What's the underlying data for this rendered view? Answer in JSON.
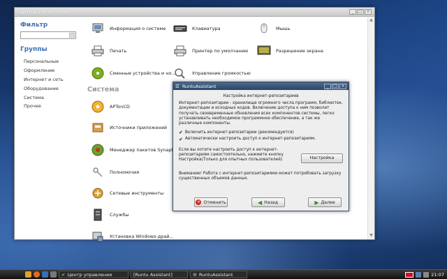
{
  "main_window": {
    "title": "Центр управления",
    "sidebar": {
      "filter_label": "Фильтр",
      "filter_value": "",
      "groups_label": "Группы",
      "groups": [
        "Персональные",
        "Оформление",
        "Интернет и сеть",
        "Оборудование",
        "Система",
        "Прочее"
      ]
    },
    "hardware_items": [
      {
        "label": "Информация о системе",
        "icon": "computer-icon"
      },
      {
        "label": "Клавиатура",
        "icon": "keyboard-icon"
      },
      {
        "label": "Мышь",
        "icon": "mouse-icon"
      },
      {
        "label": "Печать",
        "icon": "printer-icon"
      },
      {
        "label": "Принтер по умолчанию",
        "icon": "default-printer-icon"
      },
      {
        "label": "Разрешение экрана",
        "icon": "display-icon"
      },
      {
        "label": "Сменные устройства и но...",
        "icon": "cd-icon"
      },
      {
        "label": "Управление громкостью",
        "icon": "volume-icon"
      }
    ],
    "system_section_label": "Система",
    "system_items": [
      {
        "label": "APTonCD",
        "icon": "aptoncd-icon"
      },
      {
        "label": "Источники приложений",
        "icon": "sources-icon"
      },
      {
        "label": "Менеджер пакетов Synaptic",
        "icon": "synaptic-icon"
      },
      {
        "label": "Полномочия",
        "icon": "keys-icon"
      },
      {
        "label": "Сетевые инструменты",
        "icon": "network-tools-icon"
      },
      {
        "label": "Службы",
        "icon": "services-icon"
      },
      {
        "label": "Установка Windows-драй...",
        "icon": "windows-driver-icon"
      }
    ]
  },
  "dialog": {
    "title": "RuntuAssistant",
    "heading": "Настройка интернет-репозитариев",
    "description": "Интернет-репозитарии - хранилище огромного числа программ, библиотек, документации и исходных кодов. Включение доступа к ним позволит получать своевременные обновления всех компонентов системы, легко устанавливать необходимое программное обеспечение, а так же различные компоненты.",
    "checkbox_enable": "Включить интернет-репозитарии (рекомендуется)",
    "checkbox_auto": "Автоматически настроить доступ к интернет-репозитариям.",
    "manual_text": "Если вы хотите настроить доступ к интернет-репозитариям самостоятельно, нажмите кнопку Настройка(Только для опытных пользователей)",
    "settings_button": "Настройка",
    "warning": "Внимание! Работа с интернет-репозитариями может потребовать загрузку существенных объемов данных.",
    "cancel_button": "Отменить",
    "back_button": "Назад",
    "next_button": "Далее"
  },
  "taskbar": {
    "tasks": [
      "Центр управления",
      "[Runtu Assistant]",
      "RuntuAssistant"
    ],
    "clock": "21:07"
  }
}
